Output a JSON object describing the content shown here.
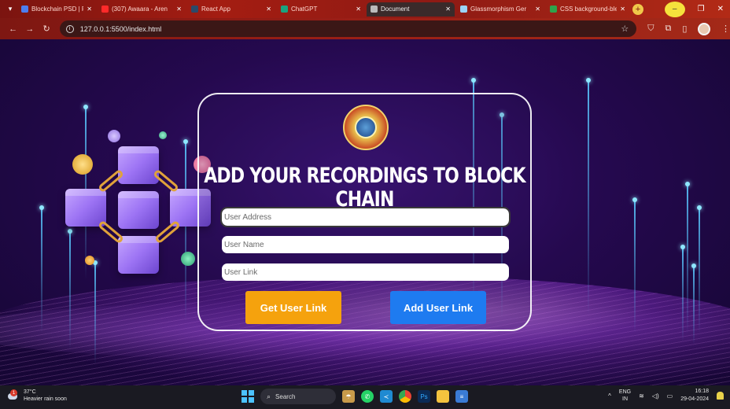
{
  "browser": {
    "tabs": [
      {
        "label": "Blockchain PSD | Fr",
        "color": "#4d7df0",
        "active": false
      },
      {
        "label": "(307) Awaara - Aren",
        "color": "#ff2a2a",
        "active": false
      },
      {
        "label": "React App",
        "color": "#2b4a6a",
        "active": false
      },
      {
        "label": "ChatGPT",
        "color": "#19a37f",
        "active": false
      },
      {
        "label": "Document",
        "color": "#bbbbbb",
        "active": true
      },
      {
        "label": "Glassmorphism Ger",
        "color": "#9bd3f7",
        "active": false
      },
      {
        "label": "CSS background-ble",
        "color": "#2fa34b",
        "active": false
      }
    ],
    "url": "127.0.0.1:5500/index.html"
  },
  "card": {
    "title": "ADD YOUR RECORDINGS TO BLOCK CHAIN",
    "fields": {
      "address_placeholder": "User Address",
      "name_placeholder": "User Name",
      "link_placeholder": "User Link"
    },
    "buttons": {
      "get_label": "Get User Link",
      "add_label": "Add User Link"
    }
  },
  "taskbar": {
    "weather_temp": "37°C",
    "weather_desc": "Heavier rain soon",
    "weather_badge": "1",
    "search_label": "Search",
    "lang_top": "ENG",
    "lang_bottom": "IN",
    "time": "16:18",
    "date": "29-04-2024"
  },
  "icons": [
    "tab-menu-icon",
    "back-icon",
    "forward-icon",
    "reload-icon",
    "info-icon",
    "star-icon",
    "windows-icon",
    "search-icon",
    "whatsapp-icon",
    "vscode-icon",
    "chrome-icon",
    "photoshop-icon",
    "folder-icon",
    "notes-icon",
    "wifi-icon",
    "volume-icon",
    "battery-icon",
    "notification-icon"
  ]
}
